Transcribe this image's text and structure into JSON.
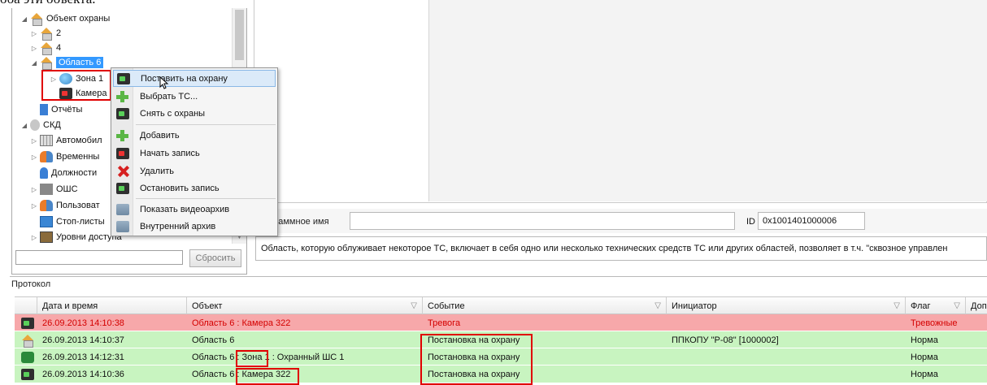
{
  "doc_fragment": "оба эти объекта.",
  "tree": {
    "items": [
      {
        "label": "Объект охраны",
        "icon": "house-icon"
      },
      {
        "label": "2",
        "icon": "house-icon"
      },
      {
        "label": "4",
        "icon": "house-icon"
      },
      {
        "label": "Область 6",
        "icon": "house-icon"
      },
      {
        "label": "Зона 1",
        "icon": "zone-icon"
      },
      {
        "label": "Камера",
        "icon": "camera-icon"
      },
      {
        "label": "Отчёты",
        "icon": "report-icon"
      },
      {
        "label": "СКД",
        "icon": "key-icon"
      },
      {
        "label": "Автомобил",
        "icon": "grid-icon"
      },
      {
        "label": "Временны",
        "icon": "schedule-icon"
      },
      {
        "label": "Должности",
        "icon": "person-icon"
      },
      {
        "label": "ОШС",
        "icon": "org-icon"
      },
      {
        "label": "Пользоват",
        "icon": "users-icon"
      },
      {
        "label": "Стоп-листы",
        "icon": "card-icon"
      },
      {
        "label": "Уровни доступа",
        "icon": "door-icon"
      }
    ],
    "reset_label": "Сбросить",
    "search_value": ""
  },
  "context_menu": {
    "items": [
      {
        "label": "Поставить на охрану",
        "icon": "arm-camera-icon"
      },
      {
        "label": "Выбрать ТС...",
        "icon": "plus-icon"
      },
      {
        "label": "Снять с охраны",
        "icon": "disarm-camera-icon"
      },
      {
        "label": "Добавить",
        "icon": "plus-icon"
      },
      {
        "label": "Начать запись",
        "icon": "record-icon"
      },
      {
        "label": "Удалить",
        "icon": "delete-icon"
      },
      {
        "label": "Остановить запись",
        "icon": "stop-record-icon"
      },
      {
        "label": "Показать видеоархив",
        "icon": "archive-icon"
      },
      {
        "label": "Внутренний архив",
        "icon": "archive-icon"
      }
    ]
  },
  "properties": {
    "program_name_label": "ограммное имя",
    "program_name_value": "",
    "id_label": "ID",
    "id_value": "0x1001401000006",
    "description": "Область, которую облуживает некоторое ТС, включает в себя одно или несколько технических средств ТС или других областей, позволяет в т.ч. \"сквозное управлен"
  },
  "protocol": {
    "title": "Протокол",
    "columns": [
      "Дата и время",
      "Объект",
      "Событие",
      "Инициатор",
      "Флаг",
      "Доп"
    ],
    "rows": [
      {
        "datetime": "26.09.2013  14:10:38",
        "object": "Область 6 : Камера 322",
        "event": "Тревога",
        "initiator": "",
        "flag": "Тревожные",
        "status": "alarm",
        "icon": "camera-icon"
      },
      {
        "datetime": "26.09.2013  14:10:37",
        "object": "Область 6",
        "event": "Постановка на охрану",
        "initiator": "ППКОПУ \"Р-08\" [1000002]",
        "flag": "Норма",
        "status": "normal",
        "icon": "house-icon"
      },
      {
        "datetime": "26.09.2013  14:12:31",
        "object": "Область 6 : Зона 1 : Охранный ШС 1",
        "event": "Постановка на охрану",
        "initiator": "",
        "flag": "Норма",
        "status": "normal",
        "icon": "sensor-icon"
      },
      {
        "datetime": "26.09.2013  14:10:36",
        "object": "Область 6 : Камера 322",
        "event": "Постановка на охрану",
        "initiator": "",
        "flag": "Норма",
        "status": "normal",
        "icon": "camera-icon"
      }
    ]
  },
  "colors": {
    "alarm_row": "#f7a8aa",
    "normal_row": "#c8f4c0",
    "highlight_box": "#e00000",
    "selection": "#3399ff"
  }
}
